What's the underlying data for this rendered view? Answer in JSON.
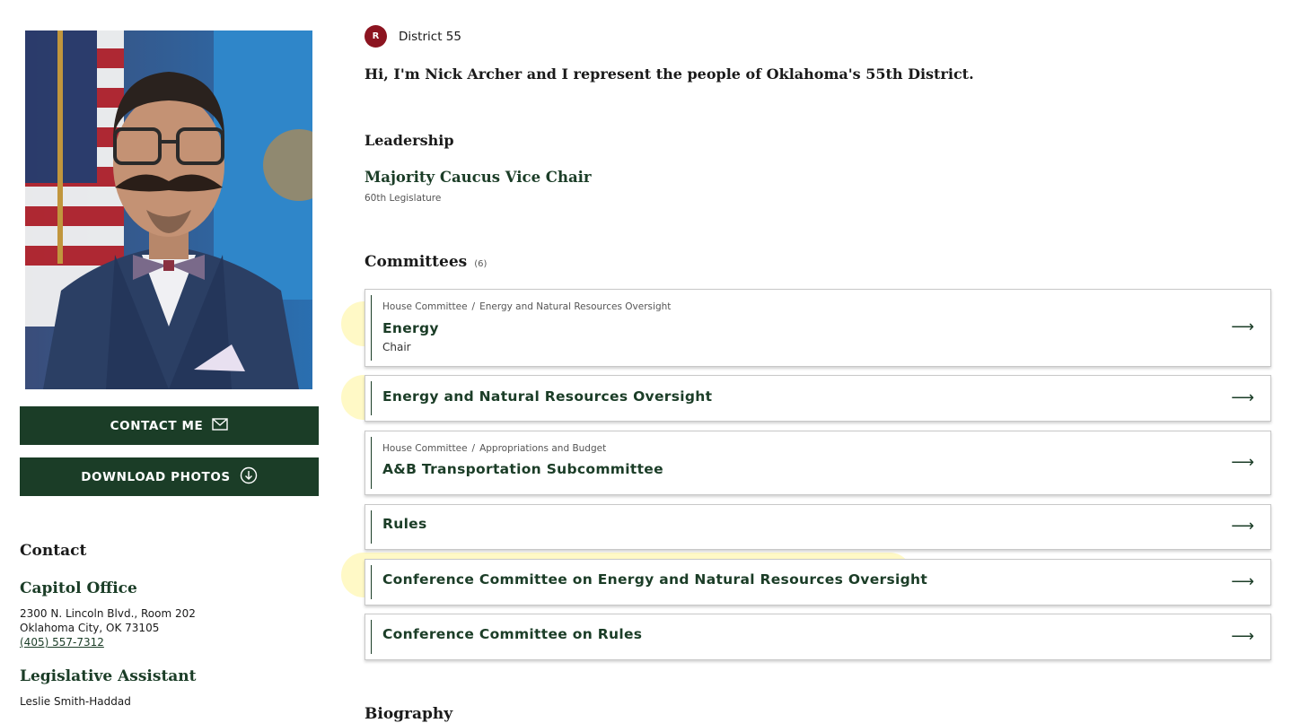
{
  "member": {
    "party_badge": "R",
    "district": "District 55",
    "intro": "Hi, I'm Nick Archer and I represent the people of Oklahoma's 55th District.",
    "photo_alt": "Portrait of Nick Archer"
  },
  "actions": {
    "contact_label": "CONTACT ME",
    "contact_icon": "envelope-icon",
    "download_label": "DOWNLOAD PHOTOS",
    "download_icon": "download-circle-icon"
  },
  "contact": {
    "heading": "Contact",
    "office_heading": "Capitol Office",
    "address_line1": "2300 N. Lincoln Blvd., Room 202",
    "address_line2": "Oklahoma City, OK 73105",
    "phone": "(405) 557-7312",
    "assistant_heading": "Legislative Assistant",
    "assistant_name": "Leslie Smith-Haddad"
  },
  "leadership": {
    "heading": "Leadership",
    "role": "Majority Caucus Vice Chair",
    "term": "60th Legislature"
  },
  "committees": {
    "heading": "Committees",
    "count": "(6)",
    "arrow": "⟶",
    "items": [
      {
        "crumb_parent": "House Committee",
        "crumb_sep": "/",
        "crumb_child": "Energy and Natural Resources Oversight",
        "title": "Energy",
        "sub": "Chair"
      },
      {
        "title": "Energy and Natural Resources Oversight"
      },
      {
        "crumb_parent": "House Committee",
        "crumb_sep": "/",
        "crumb_child": "Appropriations and Budget",
        "title": "A&B Transportation Subcommittee"
      },
      {
        "title": "Rules"
      },
      {
        "title": "Conference Committee on Energy and Natural Resources Oversight"
      },
      {
        "title": "Conference Committee on Rules"
      }
    ]
  },
  "biography": {
    "heading": "Biography"
  },
  "colors": {
    "brand_green": "#1b3d27",
    "party_red": "#8c1420",
    "highlight_yellow": "#fff078"
  }
}
